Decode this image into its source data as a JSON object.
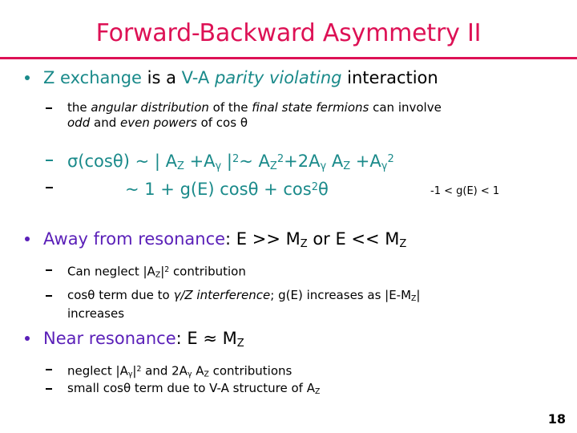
{
  "slide": {
    "title": "Forward-Backward Asymmetry II",
    "page_number": "18",
    "colors": {
      "title": "#dd1155",
      "rule": "#dd1155",
      "accent_teal": "#1a8a8a",
      "accent_purple": "#5a1fb8",
      "body_text": "#000000",
      "background": "#ffffff"
    }
  },
  "bullets": {
    "b1": {
      "seg1": "Z exchange",
      "seg2": " is a ",
      "seg3": "V-A ",
      "seg4": "parity violating",
      "seg5": " interaction"
    },
    "b1_sub1": {
      "seg1": "the ",
      "seg2": "angular distribution",
      "seg3": " of the ",
      "seg4": "final state fermions",
      "seg5": " can involve ",
      "seg6": "odd",
      "seg7": " and ",
      "seg8": "even powers",
      "seg9": " of cos ",
      "seg10": "θ"
    },
    "formula1": {
      "p1": "σ(cos",
      "theta1": "θ",
      "p2": ") ~ | A",
      "subZ1": "Z",
      "p3": " +A",
      "subg1": "γ",
      "p4": " |",
      "sup1": "2",
      "p5": "~ A",
      "subZ2": "Z",
      "sup2": "2",
      "p6": "+2A",
      "subg2": "γ",
      "p7": " A",
      "subZ3": "Z",
      "p8": " +A",
      "subg3": "γ",
      "sup3": "2"
    },
    "formula2": {
      "p1": "~ 1 + g(E) cos",
      "theta1": "θ",
      "p2": " + cos",
      "sup1": "2",
      "theta2": "θ"
    },
    "formula2_note": "-1 < g(E) < 1",
    "b2": {
      "seg1": "Away from resonance",
      "seg2": ": E >> M",
      "subZ1": "Z",
      "seg3": "  or  E << M",
      "subZ2": "Z"
    },
    "b2_sub1": {
      "p1": "Can neglect |A",
      "subZ": "Z",
      "p2": "|",
      "sup": "2",
      "p3": " contribution"
    },
    "b2_sub2": {
      "p1": "cos",
      "theta": "θ",
      "p2": " term due to ",
      "italic1": "γ/Z interference",
      "p3": ";  g(E) increases as |E-M",
      "subZ": "Z",
      "p4": "|",
      "p5": "increases"
    },
    "b3": {
      "seg1": "Near resonance",
      "seg2": ": E ≈ M",
      "subZ": "Z"
    },
    "b3_sub1": {
      "p1": "neglect |A",
      "subg1": "γ",
      "p2": "|",
      "sup1": "2",
      "p3": " and 2A",
      "subg2": "γ",
      "p4": " A",
      "subZ1": "Z",
      "p5": " contributions"
    },
    "b3_sub2": {
      "p1": "small cos",
      "theta": "θ",
      "p2": " term due to V-A structure of A",
      "subZ": "Z"
    }
  }
}
